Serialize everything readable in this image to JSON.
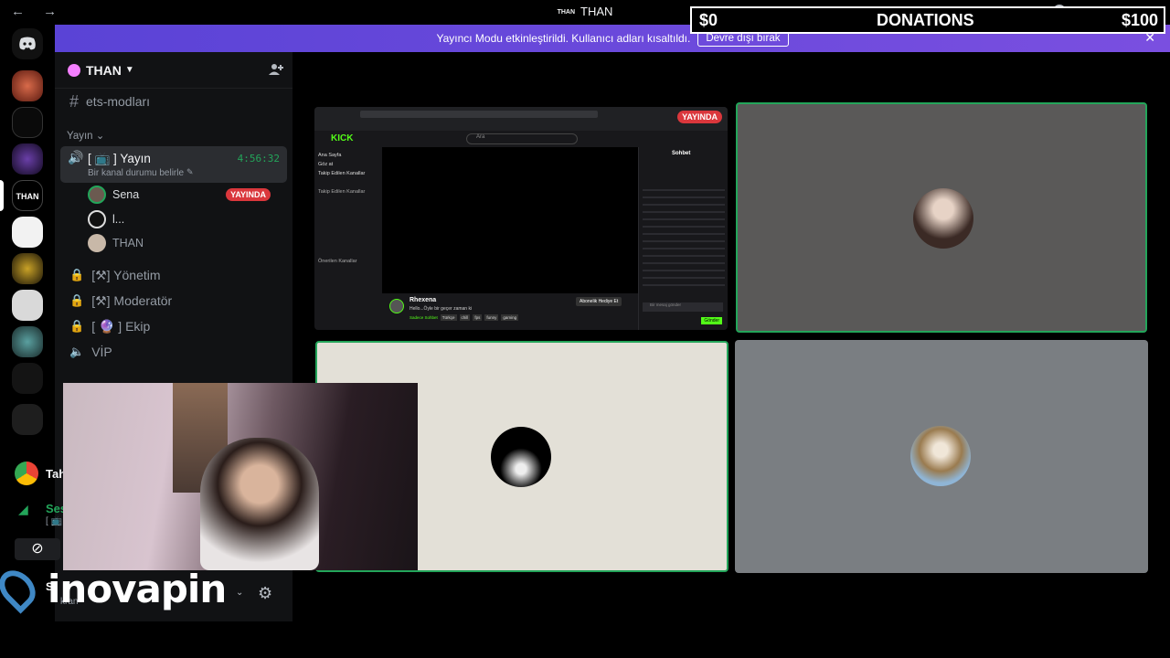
{
  "titlebar": {
    "nav": "← →",
    "badge": "THAN",
    "title": "THAN"
  },
  "donations": {
    "left": "$0",
    "center": "DONATIONS",
    "right": "$100"
  },
  "banner": {
    "text": "Yayıncı Modu etkinleştirildi. Kullanıcı adları kısaltıldı.",
    "button": "Devre dışı bırak",
    "close": "✕"
  },
  "rail": {
    "selected_label": "THAN"
  },
  "sidebar": {
    "guild_name": "THAN",
    "channels": [
      {
        "label": "ets-modları"
      }
    ],
    "category": "Yayın",
    "voice_channel": {
      "label": "[ 📺 ] Yayın",
      "timer": "4:56:32",
      "status_placeholder": "Bir kanal durumu belirle"
    },
    "voice_users": [
      {
        "name": "Sena",
        "badge": "YAYINDA"
      },
      {
        "name": "l..."
      },
      {
        "name": "THAN"
      }
    ],
    "locked_channels": [
      {
        "label": "[⚒] Yönetim"
      },
      {
        "label": "[⚒] Moderatör"
      },
      {
        "label": "[ 🔮 ] Ekip"
      }
    ],
    "vip": "VİP"
  },
  "userpanel": {
    "app_label": "Tah",
    "voice_status": "Ses",
    "voice_sub": "[ 📺",
    "username": "S",
    "sub": "kran"
  },
  "stream": {
    "live_badge": "YAYINDA",
    "site_logo": "KICK",
    "search_placeholder": "Ara",
    "nav": [
      "Ana Sayfa",
      "Göz at",
      "Takip Edilen Kanallar"
    ],
    "sections": [
      "Takip Edilen Kanallar",
      "Önerilen Kanallar"
    ],
    "streamer_name": "Rhexena",
    "stream_title": "Hello...Öyle bir geçer zaman ki",
    "tags": [
      "Sadece Sohbet",
      "Türkçe",
      "chill",
      "fps",
      "funny",
      "gaming"
    ],
    "sub_button": "Abonelik Hediye Et",
    "chat_title": "Sohbet",
    "chat_input_placeholder": "Bir mesaj gönder",
    "chat_send": "Gönder"
  },
  "logo": {
    "text": "inovapin"
  },
  "colors": {
    "blurple": "#5865f2",
    "banner": "#5c46d8",
    "live": "#da373c",
    "speaking": "#23a55a",
    "kick": "#53fc18"
  }
}
